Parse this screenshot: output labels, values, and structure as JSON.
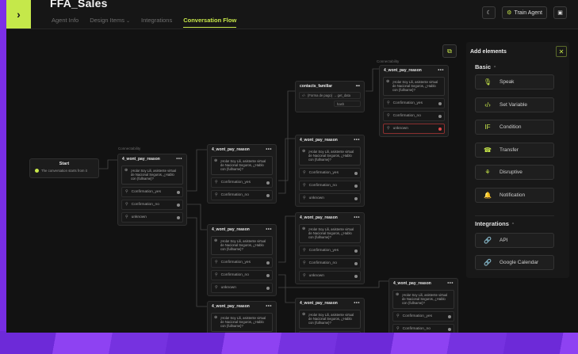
{
  "app": {
    "title": "FFA_Sales",
    "tabs": [
      {
        "label": "Agent Info"
      },
      {
        "label": "Design Items"
      },
      {
        "label": "Integrations"
      },
      {
        "label": "Conversation Flow"
      }
    ],
    "train_label": "Train Agent",
    "accent": "#c8e84a"
  },
  "canvas": {
    "start": {
      "title": "Start",
      "row": "The conversation starts from it"
    },
    "tag": "Connectability",
    "node_title": "4_wont_pay_reason",
    "node_msg": "¡Hola! Soy Lili, asistente virtual de Nacional Seguros, ¿Hablo con {fullname}?",
    "opt_yes": "Confirmation_yes",
    "opt_no": "Confirmation_no",
    "opt_unknown": "unknown",
    "contacts_node": {
      "title": "contacts_familiar",
      "row1": "{Forma de pago} → get_data",
      "row2": "hash"
    }
  },
  "panel": {
    "title": "Add elements",
    "basic_label": "Basic",
    "basic_items": [
      {
        "label": "Speak",
        "icon": "microphone-icon"
      },
      {
        "label": "Set Variable",
        "icon": "code-icon"
      },
      {
        "label": "Condition",
        "icon": "if-icon"
      },
      {
        "label": "Transfer",
        "icon": "phone-transfer-icon"
      },
      {
        "label": "Disruptive",
        "icon": "disruptive-icon"
      },
      {
        "label": "Notification",
        "icon": "bell-icon"
      }
    ],
    "integrations_label": "Integrations",
    "integration_items": [
      {
        "label": "API",
        "icon": "link-icon"
      },
      {
        "label": "Google Calendar",
        "icon": "link-icon"
      }
    ]
  }
}
